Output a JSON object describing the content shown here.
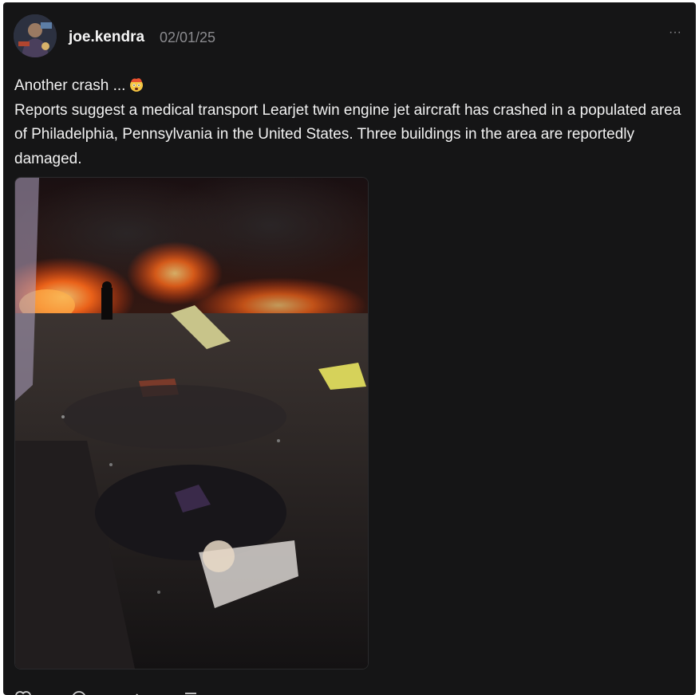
{
  "post": {
    "username": "joe.kendra",
    "date": "02/01/25",
    "more_label": "···",
    "text_line1": "Another crash ...",
    "emoji_icon": "exploding-head-emoji",
    "text_paragraph": "Reports suggest a medical transport Learjet twin engine jet aircraft has crashed in a populated area of Philadelphia, Pennsylvania in the United States. Three buildings in the area are reportedly damaged."
  },
  "actions": {
    "icons": [
      "like-icon",
      "comment-icon",
      "repost-icon",
      "share-icon"
    ]
  },
  "colors": {
    "background": "#151516",
    "text": "#f1f1f1",
    "muted": "#8a8a8e"
  }
}
